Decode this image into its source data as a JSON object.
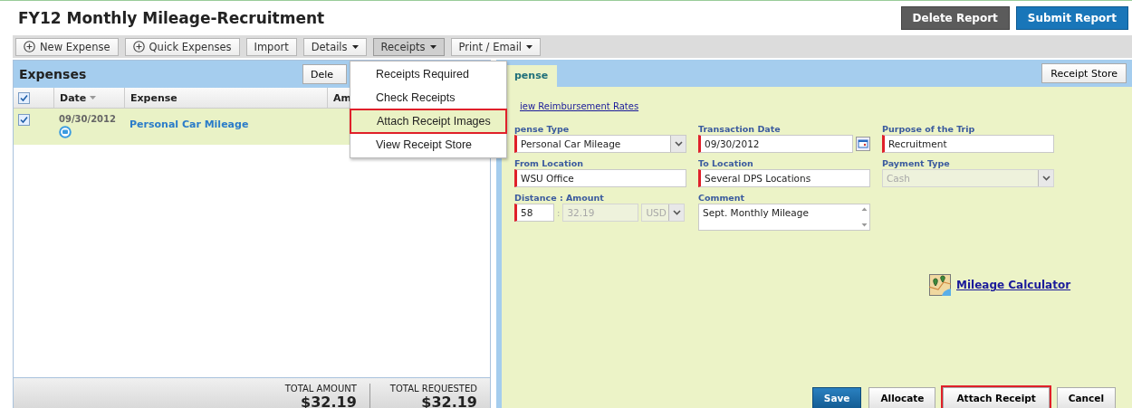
{
  "report": {
    "title": "FY12 Monthly Mileage-Recruitment",
    "actions": [
      {
        "label": "Delete Report",
        "kind": "secondary"
      },
      {
        "label": "Submit Report",
        "kind": "primary"
      }
    ]
  },
  "toolbar": [
    {
      "label": "New Expense",
      "kind": "add",
      "expanded": false
    },
    {
      "label": "Quick Expenses",
      "kind": "add",
      "expanded": false
    },
    {
      "label": "Import",
      "kind": "plain",
      "expanded": false
    },
    {
      "label": "Details",
      "kind": "menu",
      "expanded": false
    },
    {
      "label": "Receipts",
      "kind": "menu",
      "expanded": true
    },
    {
      "label": "Print / Email",
      "kind": "menu",
      "expanded": false
    }
  ],
  "receipts_menu": [
    {
      "label": "Receipts Required",
      "highlighted": false
    },
    {
      "label": "Check Receipts",
      "highlighted": false
    },
    {
      "label": "Attach Receipt Images",
      "highlighted": true
    },
    {
      "label": "View Receipt Store",
      "highlighted": false
    }
  ],
  "expenses": {
    "title": "Expenses",
    "delete_button": "Dele",
    "all_checked": true,
    "columns": [
      "Date",
      "Expense",
      "Am"
    ],
    "rows": [
      {
        "checked": true,
        "date": "09/30/2012",
        "expense": "Personal Car Mileage",
        "has_comment": true
      }
    ],
    "totals": [
      {
        "label": "TOTAL AMOUNT",
        "value": "$32.19"
      },
      {
        "label": "TOTAL REQUESTED",
        "value": "$32.19"
      }
    ]
  },
  "detail": {
    "tab": "pense",
    "receipt_store": "Receipt Store",
    "rates_link": "iew Reimbursement Rates",
    "fields": [
      {
        "label": "pense Type",
        "kind": "select",
        "value": "Personal Car Mileage",
        "required": true,
        "disabled": false
      },
      {
        "label": "Transaction Date",
        "kind": "date",
        "value": "09/30/2012",
        "required": true,
        "disabled": false
      },
      {
        "label": "Purpose of the Trip",
        "kind": "text",
        "value": "Recruitment",
        "required": true,
        "disabled": false
      },
      {
        "label": "From Location",
        "kind": "text",
        "value": "WSU Office",
        "required": true,
        "disabled": false
      },
      {
        "label": "To Location",
        "kind": "text",
        "value": "Several DPS Locations",
        "required": true,
        "disabled": false
      },
      {
        "label": "Payment Type",
        "kind": "select",
        "value": "Cash",
        "required": false,
        "disabled": true
      },
      {
        "label": "Distance : Amount",
        "kind": "distance",
        "value": "58",
        "separator": ":",
        "amount": "32.19",
        "currency": "USD",
        "required": true,
        "disabled": false
      },
      {
        "label": "Comment",
        "kind": "textarea",
        "value": "Sept. Monthly Mileage",
        "required": false,
        "disabled": false
      }
    ],
    "mileage_link": "Mileage Calculator",
    "buttons": [
      {
        "label": "Save",
        "kind": "primary",
        "highlighted": false
      },
      {
        "label": "Allocate",
        "kind": "plain",
        "highlighted": false
      },
      {
        "label": "Attach Receipt",
        "kind": "plain",
        "highlighted": true
      },
      {
        "label": "Cancel",
        "kind": "plain",
        "highlighted": false
      }
    ]
  }
}
